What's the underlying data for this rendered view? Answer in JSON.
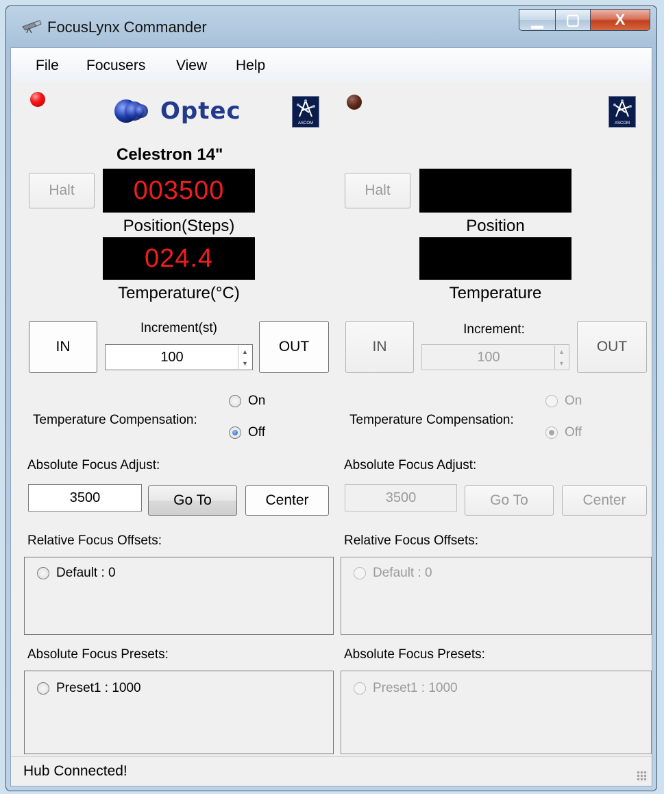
{
  "window": {
    "title": "FocusLynx Commander",
    "minimize_glyph": "▁",
    "maximize_glyph": "▢",
    "close_glyph": "X"
  },
  "menu": [
    "File",
    "Focusers",
    "View",
    "Help"
  ],
  "logo": {
    "text": "Optec",
    "ascom_left": "ASCOM",
    "ascom_right": "ASCOM"
  },
  "focuser1": {
    "status_led": "red",
    "name": "Celestron 14\"",
    "halt": "Halt",
    "position_value": "003500",
    "position_label": "Position(Steps)",
    "temperature_value": "024.4",
    "temperature_label": "Temperature(°C)",
    "in": "IN",
    "out": "OUT",
    "increment_label": "Increment(st)",
    "increment_value": "100",
    "temp_comp_label": "Temperature Compensation:",
    "temp_comp_on": "On",
    "temp_comp_off": "Off",
    "abs_focus_label": "Absolute Focus Adjust:",
    "abs_focus_value": "3500",
    "goto": "Go To",
    "center": "Center",
    "rel_offsets_label": "Relative Focus Offsets:",
    "rel_offset_item": "Default : 0",
    "abs_presets_label": "Absolute Focus Presets:",
    "abs_preset_item": "Preset1 : 1000"
  },
  "focuser2": {
    "status_led": "brown",
    "halt": "Halt",
    "position_value": "",
    "position_label": "Position",
    "temperature_value": "",
    "temperature_label": "Temperature",
    "in": "IN",
    "out": "OUT",
    "increment_label": "Increment:",
    "increment_value": "100",
    "temp_comp_label": "Temperature Compensation:",
    "temp_comp_on": "On",
    "temp_comp_off": "Off",
    "abs_focus_label": "Absolute Focus Adjust:",
    "abs_focus_value": "3500",
    "goto": "Go To",
    "center": "Center",
    "rel_offsets_label": "Relative Focus Offsets:",
    "rel_offset_item": "Default : 0",
    "abs_presets_label": "Absolute Focus Presets:",
    "abs_preset_item": "Preset1 : 1000"
  },
  "status": {
    "text": "Hub Connected!"
  },
  "colors": {
    "lcd_text": "#f21d1d",
    "led_active": "#f21818",
    "led_inactive": "#5a2618"
  }
}
